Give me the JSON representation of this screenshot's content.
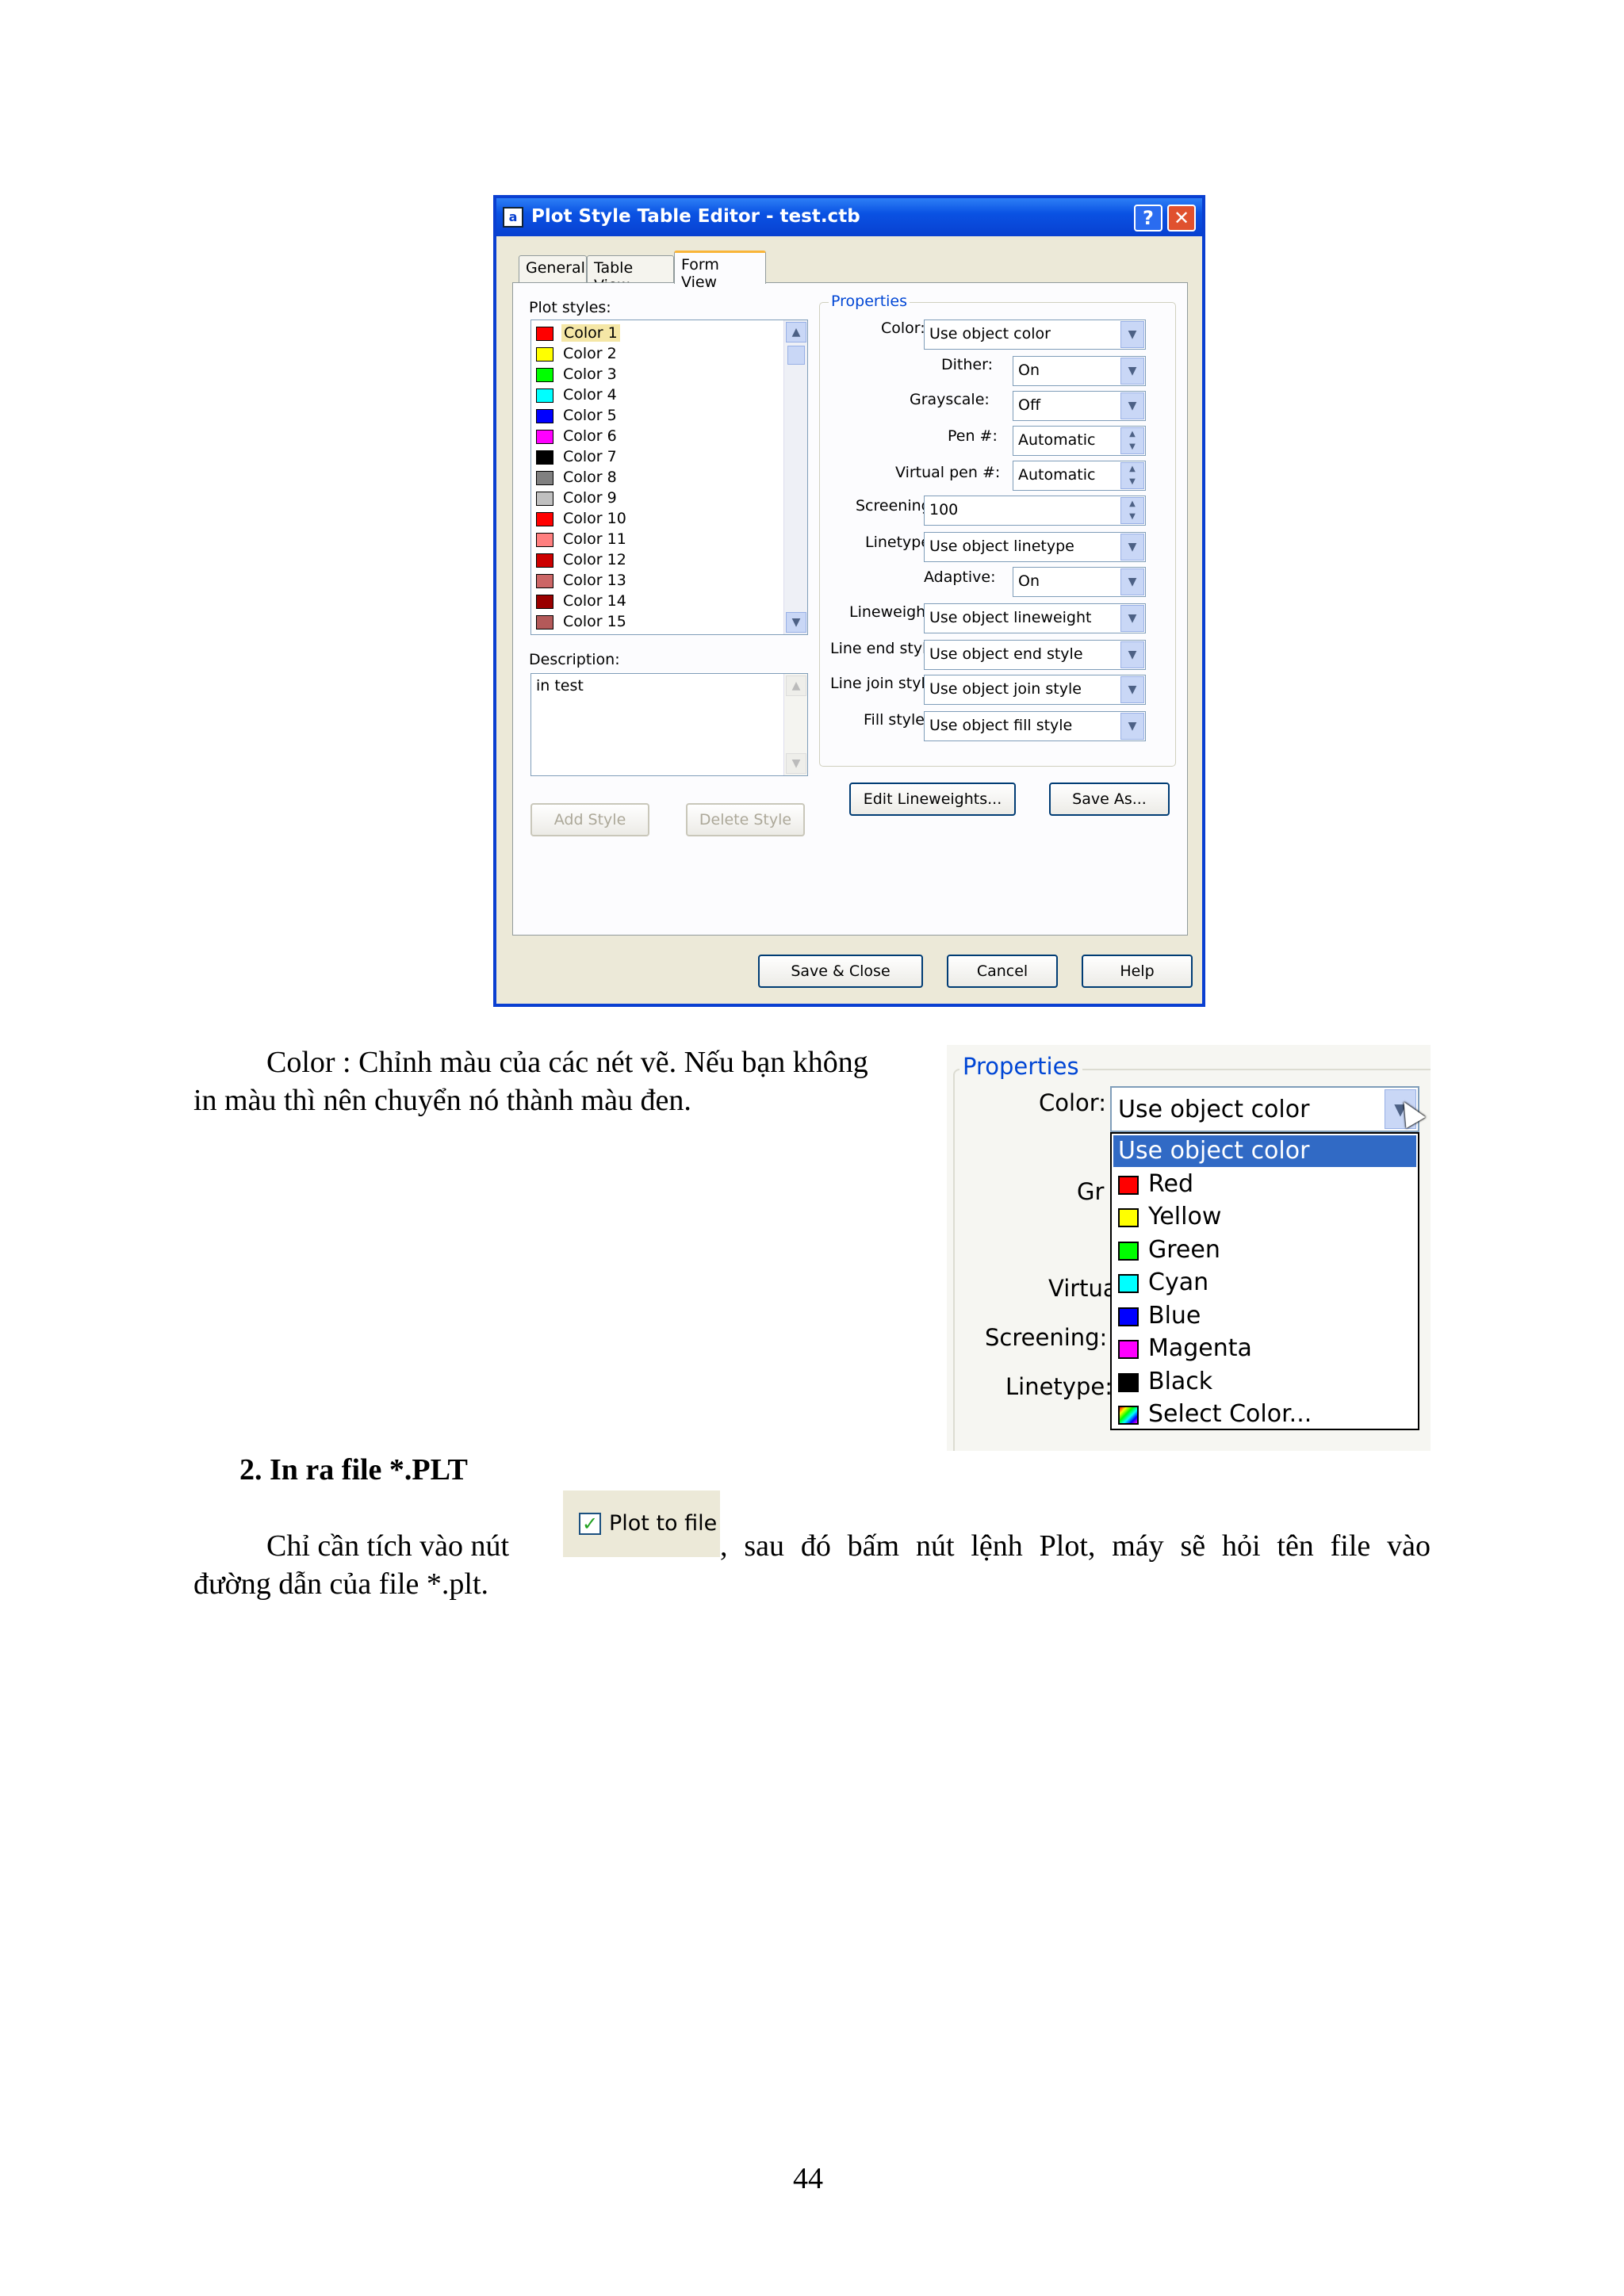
{
  "dialog": {
    "title": "Plot Style Table Editor - test.ctb",
    "app_icon_glyph": "a",
    "help_glyph": "?",
    "close_glyph": "✕",
    "tabs": [
      "General",
      "Table View",
      "Form View"
    ],
    "plot_styles_label": "Plot styles:",
    "plot_styles": [
      {
        "label": "Color 1",
        "color": "#ff0000",
        "selected": true
      },
      {
        "label": "Color 2",
        "color": "#ffff00"
      },
      {
        "label": "Color 3",
        "color": "#00ff00"
      },
      {
        "label": "Color 4",
        "color": "#00ffff"
      },
      {
        "label": "Color 5",
        "color": "#0000ff"
      },
      {
        "label": "Color 6",
        "color": "#ff00ff"
      },
      {
        "label": "Color 7",
        "color": "#000000"
      },
      {
        "label": "Color 8",
        "color": "#808080"
      },
      {
        "label": "Color 9",
        "color": "#c0c0c0"
      },
      {
        "label": "Color 10",
        "color": "#ff0000"
      },
      {
        "label": "Color 11",
        "color": "#ff7f7f"
      },
      {
        "label": "Color 12",
        "color": "#cc0000"
      },
      {
        "label": "Color 13",
        "color": "#cc6666"
      },
      {
        "label": "Color 14",
        "color": "#990000"
      },
      {
        "label": "Color 15",
        "color": "#b35959"
      }
    ],
    "description_label": "Description:",
    "description_value": "in test",
    "add_style": "Add Style",
    "delete_style": "Delete Style",
    "properties_title": "Properties",
    "properties": {
      "color": {
        "label": "Color:",
        "value": "Use object color"
      },
      "dither": {
        "label": "Dither:",
        "value": "On"
      },
      "grayscale": {
        "label": "Grayscale:",
        "value": "Off"
      },
      "pen": {
        "label": "Pen #:",
        "value": "Automatic"
      },
      "virtual_pen": {
        "label": "Virtual pen #:",
        "value": "Automatic"
      },
      "screening": {
        "label": "Screening:",
        "value": "100"
      },
      "linetype": {
        "label": "Linetype:",
        "value": "Use object linetype"
      },
      "adaptive": {
        "label": "Adaptive:",
        "value": "On"
      },
      "lineweight": {
        "label": "Lineweight:",
        "value": "Use object lineweight"
      },
      "line_end": {
        "label": "Line end style:",
        "value": "Use object end style"
      },
      "line_join": {
        "label": "Line join style:",
        "value": "Use object join style"
      },
      "fill": {
        "label": "Fill style:",
        "value": "Use object fill style"
      }
    },
    "edit_lineweights": "Edit Lineweights...",
    "save_as": "Save As...",
    "save_close": "Save & Close",
    "cancel": "Cancel",
    "help": "Help"
  },
  "text": {
    "para1_line1": "Color : Chỉnh màu của các nét vẽ. Nếu bạn không",
    "para1_line2": "in màu thì nên chuyển nó thành màu đen.",
    "section_heading": "2.   In ra file *.PLT",
    "para2_line1a": "Chỉ cần tích vào nút",
    "para2_line1b": ", sau đó bấm nút lệnh Plot, máy sẽ hỏi tên file vào",
    "para2_line2": "đường dẫn của file *.plt.",
    "page_number": "44"
  },
  "zoom": {
    "properties_title": "Properties",
    "color_label": "Color:",
    "combo_value": "Use object color",
    "partial_labels": {
      "gr": "Gr",
      "virtua": "Virtua",
      "screening": "Screening:",
      "linetype": "Linetype:"
    },
    "options": [
      {
        "label": "Use object color",
        "highlighted": true
      },
      {
        "label": "Red",
        "color": "#ff0000"
      },
      {
        "label": "Yellow",
        "color": "#ffff00"
      },
      {
        "label": "Green",
        "color": "#00ff00"
      },
      {
        "label": "Cyan",
        "color": "#00ffff"
      },
      {
        "label": "Blue",
        "color": "#0000ff"
      },
      {
        "label": "Magenta",
        "color": "#ff00ff"
      },
      {
        "label": "Black",
        "color": "#000000"
      },
      {
        "label": "Select Color...",
        "color": "multicolor"
      }
    ]
  },
  "plot_to_file": {
    "label": "Plot to file",
    "checked": true,
    "check_glyph": "✓"
  }
}
